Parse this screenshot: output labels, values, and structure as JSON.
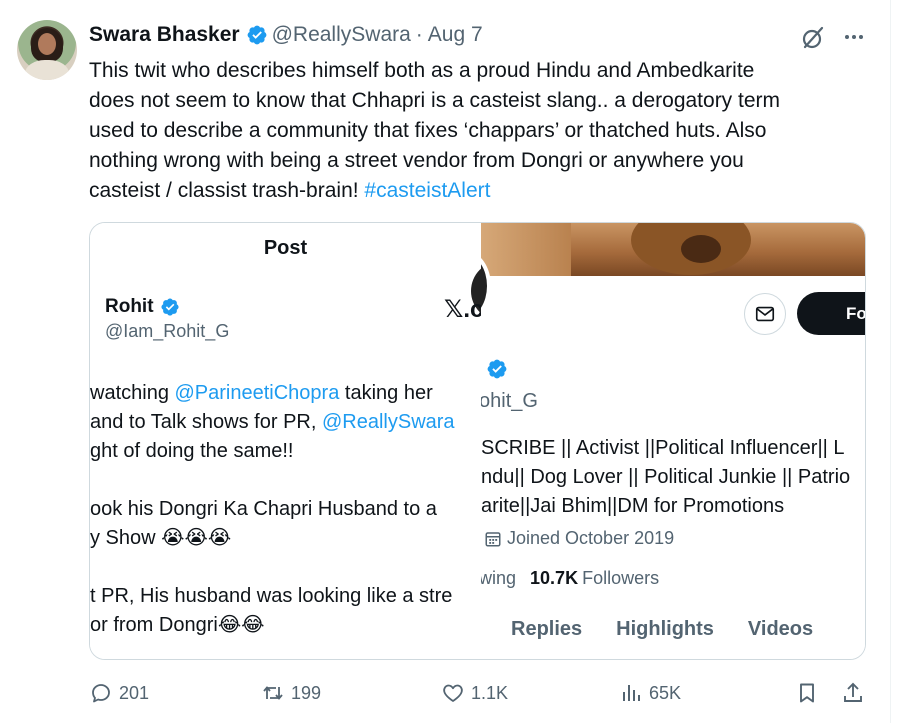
{
  "author": {
    "display_name": "Swara Bhasker",
    "handle": "@ReallySwara",
    "separator": "·",
    "date": "Aug 7"
  },
  "tweet": {
    "lines": [
      "This twit who describes himself both as a proud Hindu and Ambedkarite",
      "does not seem to know that Chhapri is a casteist slang.. a derogatory term",
      "used to describe a community that fixes ‘chappars’ or thatched huts. Also",
      "nothing wrong with being a street vendor from Dongri or anywhere you",
      "casteist / classist trash-brain! "
    ],
    "hashtag": "#casteistAlert"
  },
  "embedded_left": {
    "title": "Post",
    "name": "Rohit",
    "handle": "@Iam_Rohit_G",
    "x_logo_text": "𝕏.c",
    "line1_a": " watching ",
    "line1_mention": "@ParineetiChopra",
    "line1_b": " taking her",
    "line2_a": "and to Talk shows for PR, ",
    "line2_mention": "@ReallySwara",
    "line3": "ght of doing the same!!",
    "line4": "ook his Dongri Ka Chapri Husband to a",
    "line5": "y Show 😭😭😭",
    "line6": "t PR, His husband was looking like a stre",
    "line7": "or from Dongri😂😂"
  },
  "embedded_right": {
    "follow_label": "Fo",
    "handle_fragment": "ohit_G",
    "bio": [
      "SCRIBE || Activist ||Political Influencer|| L",
      "ndu|| Dog Lover || Political Junkie || Patrio",
      "arite||Jai Bhim||DM for Promotions"
    ],
    "joined": "Joined October 2019",
    "following_fragment": "wing",
    "followers_count": "10.7K",
    "followers_label": "Followers",
    "tabs": [
      "Replies",
      "Highlights",
      "Videos"
    ]
  },
  "actions": {
    "replies": "201",
    "reposts": "199",
    "likes": "1.1K",
    "views": "65K"
  },
  "icons": {
    "verified": "verified-badge-icon",
    "grok": "grok-icon",
    "more": "more-icon",
    "mail": "mail-icon",
    "calendar": "calendar-icon",
    "reply": "reply-icon",
    "repost": "repost-icon",
    "like": "heart-icon",
    "views": "views-icon",
    "bookmark": "bookmark-icon",
    "share": "share-icon"
  },
  "colors": {
    "accent": "#1d9bf0",
    "text": "#0f1419",
    "muted": "#536471",
    "border": "#cfd9de"
  }
}
